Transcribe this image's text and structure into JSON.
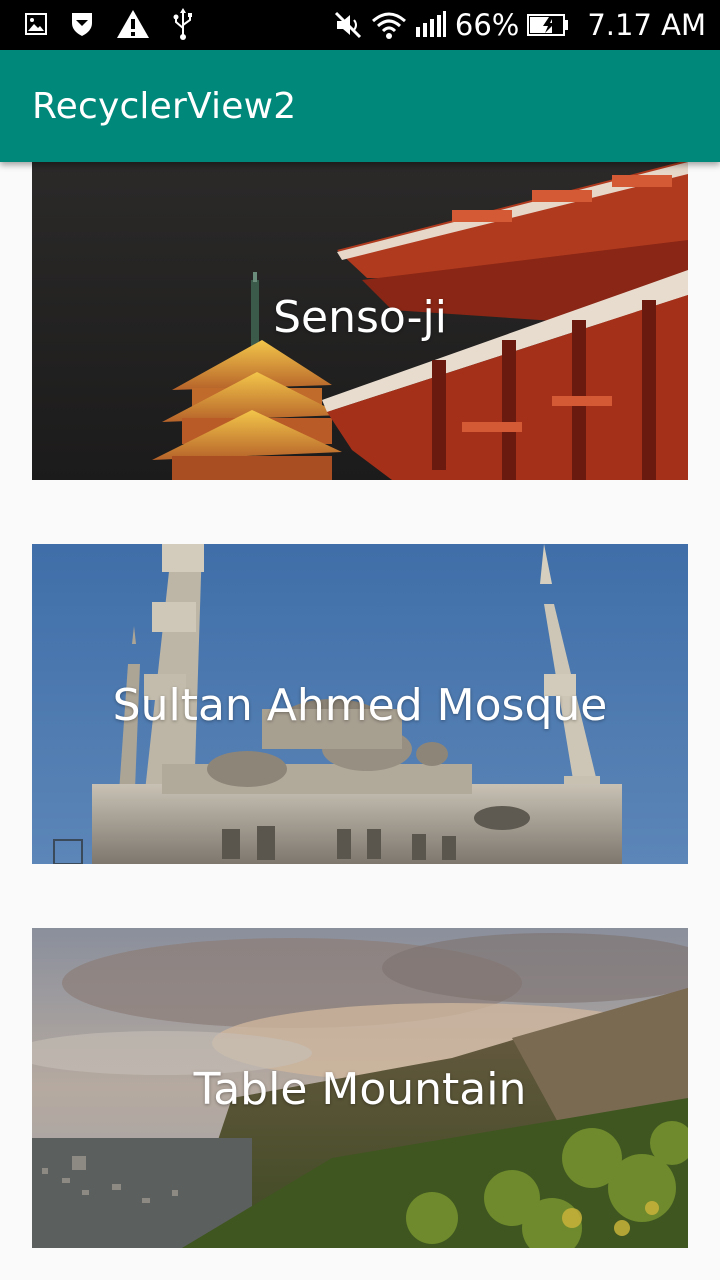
{
  "status_bar": {
    "battery_percent": "66%",
    "time": "7.17 AM",
    "left_icons": [
      "image-notification-icon",
      "shield-icon",
      "warning-icon",
      "usb-icon"
    ],
    "right_icons": [
      "mute-icon",
      "wifi-icon",
      "signal-icon",
      "battery-charging-icon"
    ]
  },
  "app_bar": {
    "title": "RecyclerView2",
    "color": "#00897b"
  },
  "list": {
    "items": [
      {
        "label": "Senso-ji",
        "image": "temple-pagoda-image"
      },
      {
        "label": "Sultan Ahmed Mosque",
        "image": "mosque-minarets-image"
      },
      {
        "label": "Table Mountain",
        "image": "mountain-landscape-image"
      }
    ]
  }
}
